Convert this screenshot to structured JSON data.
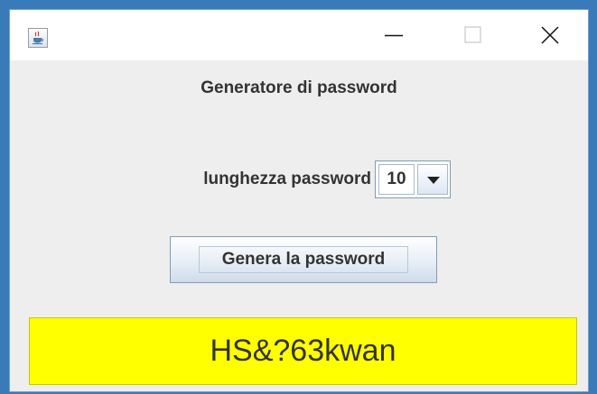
{
  "window": {
    "title": ""
  },
  "main": {
    "heading": "Generatore di password",
    "length_label": "lunghezza password",
    "length_value": "10",
    "generate_button": "Genera la password",
    "password_output": "HS&?63kwan"
  },
  "colors": {
    "output_background": "#ffff00",
    "window_background": "#eeeeee"
  },
  "icons": {
    "app": "java-app-icon",
    "minimize": "minimize-icon",
    "maximize": "maximize-icon",
    "close": "close-icon",
    "dropdown": "chevron-down-icon"
  }
}
